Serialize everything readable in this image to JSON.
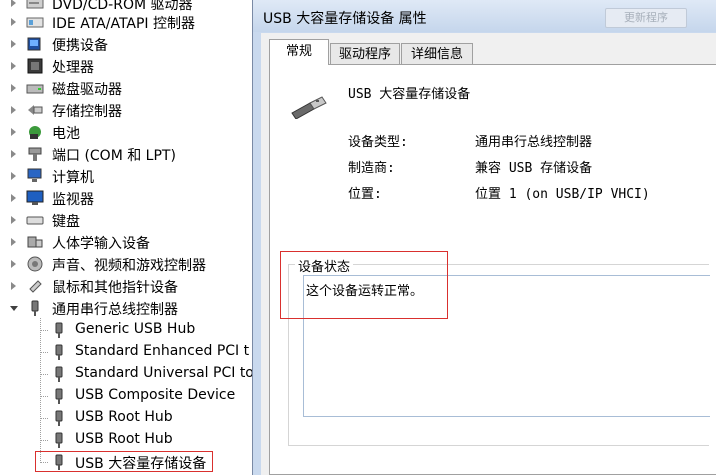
{
  "device_tree": {
    "categories": [
      {
        "label": "DVD/CD-ROM 驱动器",
        "icon": "dvd-drive-icon"
      },
      {
        "label": "IDE ATA/ATAPI 控制器",
        "icon": "ide-controller-icon"
      },
      {
        "label": "便携设备",
        "icon": "portable-device-icon"
      },
      {
        "label": "处理器",
        "icon": "processor-icon"
      },
      {
        "label": "磁盘驱动器",
        "icon": "disk-drive-icon"
      },
      {
        "label": "存储控制器",
        "icon": "storage-controller-icon"
      },
      {
        "label": "电池",
        "icon": "battery-icon"
      },
      {
        "label": "端口 (COM 和 LPT)",
        "icon": "port-icon"
      },
      {
        "label": "计算机",
        "icon": "computer-icon"
      },
      {
        "label": "监视器",
        "icon": "monitor-icon"
      },
      {
        "label": "键盘",
        "icon": "keyboard-icon"
      },
      {
        "label": "人体学输入设备",
        "icon": "hid-icon"
      },
      {
        "label": "声音、视频和游戏控制器",
        "icon": "sound-icon"
      },
      {
        "label": "鼠标和其他指针设备",
        "icon": "mouse-icon"
      },
      {
        "label": "通用串行总线控制器",
        "icon": "usb-icon",
        "expanded": true
      }
    ],
    "usb_children": [
      {
        "label": "Generic USB Hub"
      },
      {
        "label": "Standard Enhanced PCI t"
      },
      {
        "label": "Standard Universal PCI to"
      },
      {
        "label": "USB Composite Device"
      },
      {
        "label": "USB Root Hub"
      },
      {
        "label": "USB Root Hub"
      },
      {
        "label": "USB 大容量存储设备",
        "selected": true
      }
    ]
  },
  "dialog": {
    "title": "USB 大容量存储设备 属性",
    "background_tab": "更新程序",
    "tabs": [
      "常规",
      "驱动程序",
      "详细信息"
    ],
    "active_tab": "常规",
    "device_name": "USB 大容量存储设备",
    "properties": [
      {
        "label": "设备类型:",
        "value": "通用串行总线控制器"
      },
      {
        "label": "制造商:",
        "value": "兼容 USB 存储设备"
      },
      {
        "label": "位置:",
        "value": "位置 1 (on USB/IP VHCI)"
      }
    ],
    "status_group_title": "设备状态",
    "status_text": "这个设备运转正常。"
  },
  "colors": {
    "highlight_border": "#d9302e",
    "titlebar": "#c9d9ee",
    "tab_face": "#e8e8e8"
  }
}
